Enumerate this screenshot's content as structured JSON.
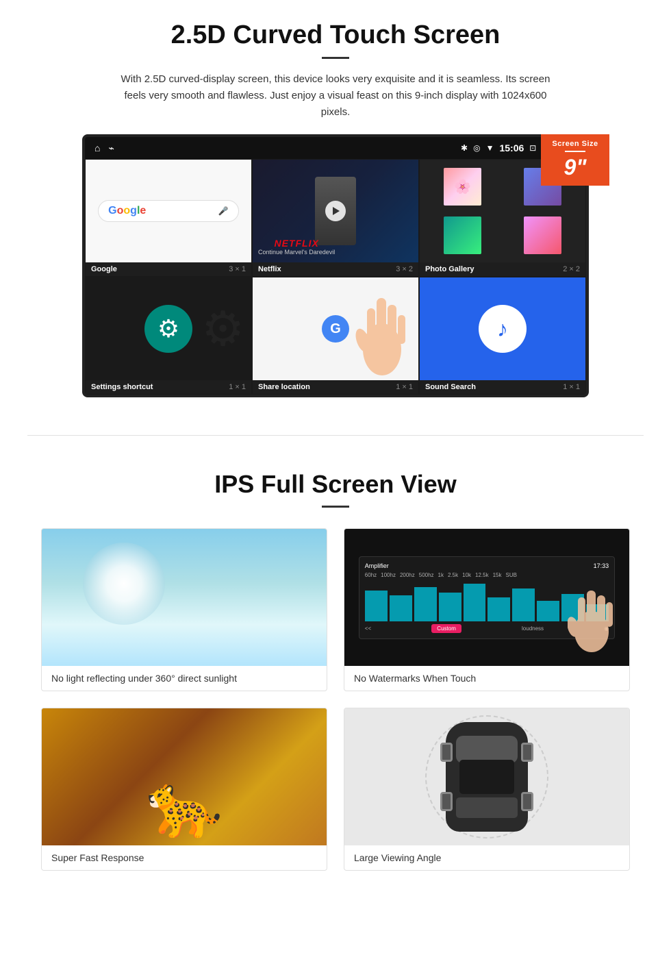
{
  "section1": {
    "title": "2.5D Curved Touch Screen",
    "description": "With 2.5D curved-display screen, this device looks very exquisite and it is seamless. Its screen feels very smooth and flawless. Just enjoy a visual feast on this 9-inch display with 1024x600 pixels.",
    "badge": {
      "label": "Screen Size",
      "size": "9\""
    },
    "status_bar": {
      "time": "15:06"
    },
    "apps": [
      {
        "name": "Google",
        "size": "3 × 1"
      },
      {
        "name": "Netflix",
        "size": "3 × 2",
        "subtitle": "Continue Marvel's Daredevil"
      },
      {
        "name": "Photo Gallery",
        "size": "2 × 2"
      },
      {
        "name": "Settings shortcut",
        "size": "1 × 1"
      },
      {
        "name": "Share location",
        "size": "1 × 1"
      },
      {
        "name": "Sound Search",
        "size": "1 × 1"
      }
    ]
  },
  "section2": {
    "title": "IPS Full Screen View",
    "features": [
      {
        "id": "sunlight",
        "caption": "No light reflecting under 360° direct sunlight"
      },
      {
        "id": "amplifier",
        "caption": "No Watermarks When Touch"
      },
      {
        "id": "cheetah",
        "caption": "Super Fast Response"
      },
      {
        "id": "car",
        "caption": "Large Viewing Angle"
      }
    ]
  }
}
